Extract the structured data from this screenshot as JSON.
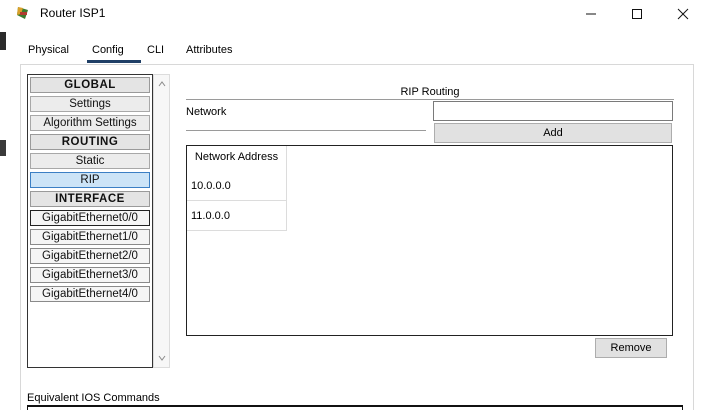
{
  "window": {
    "title": "Router ISP1"
  },
  "tabs": [
    {
      "label": "Physical"
    },
    {
      "label": "Config",
      "active": true
    },
    {
      "label": "CLI"
    },
    {
      "label": "Attributes"
    }
  ],
  "nav": {
    "global_header": "GLOBAL",
    "global_items": [
      "Settings",
      "Algorithm Settings"
    ],
    "routing_header": "ROUTING",
    "routing_items": [
      "Static",
      "RIP"
    ],
    "selected": "RIP",
    "interface_header": "INTERFACE",
    "interface_items": [
      "GigabitEthernet0/0",
      "GigabitEthernet1/0",
      "GigabitEthernet2/0",
      "GigabitEthernet3/0",
      "GigabitEthernet4/0"
    ]
  },
  "rip": {
    "heading": "RIP Routing",
    "network_label": "Network",
    "network_value": "",
    "add_label": "Add",
    "table_header": "Network Address",
    "networks": [
      "10.0.0.0",
      "11.0.0.0"
    ],
    "remove_label": "Remove"
  },
  "ios": {
    "label": "Equivalent IOS Commands"
  },
  "icons": {
    "app": "router-app-icon",
    "minimize": "minimize-icon",
    "maximize": "maximize-icon",
    "close": "close-icon",
    "scroll_up": "scroll-up-icon",
    "scroll_down": "scroll-down-icon"
  },
  "colors": {
    "selection": "#cce4f7",
    "selection_border": "#3b7fc4",
    "tab_underline": "#1f3f66",
    "button_face": "#e1e1e1"
  }
}
